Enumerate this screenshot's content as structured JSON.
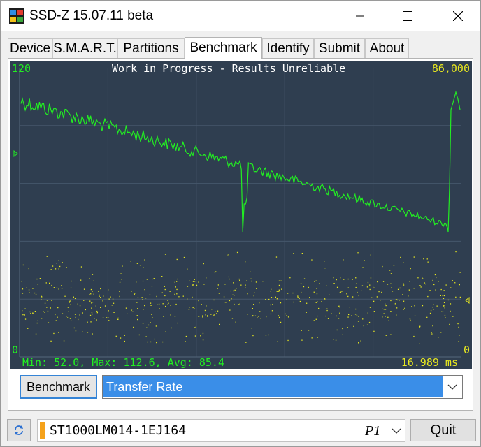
{
  "window": {
    "title": "SSD-Z 15.07.11 beta"
  },
  "tabs": [
    {
      "label": "Device"
    },
    {
      "label": "S.M.A.R.T."
    },
    {
      "label": "Partitions"
    },
    {
      "label": "Benchmark",
      "active": true
    },
    {
      "label": "Identify"
    },
    {
      "label": "Submit"
    },
    {
      "label": "About"
    }
  ],
  "chart_data": {
    "type": "line+scatter",
    "title": "Work in Progress - Results Unreliable",
    "y_left_max": "120",
    "y_left_min": "0",
    "y_right_max": "86,000",
    "y_right_min": "0",
    "stats": "Min: 52.0, Max: 112.6, Avg: 85.4",
    "time": "16.989 ms",
    "grid": true,
    "colors": {
      "background": "#2f3e50",
      "line": "#22ee22",
      "scatter": "#e8e820",
      "grid": "#46576b"
    }
  },
  "controls": {
    "benchmark_label": "Benchmark",
    "test_selected": "Transfer Rate"
  },
  "footer": {
    "drive_name": "ST1000LM014-1EJ164",
    "drive_partition": "P1",
    "quit_label": "Quit"
  }
}
